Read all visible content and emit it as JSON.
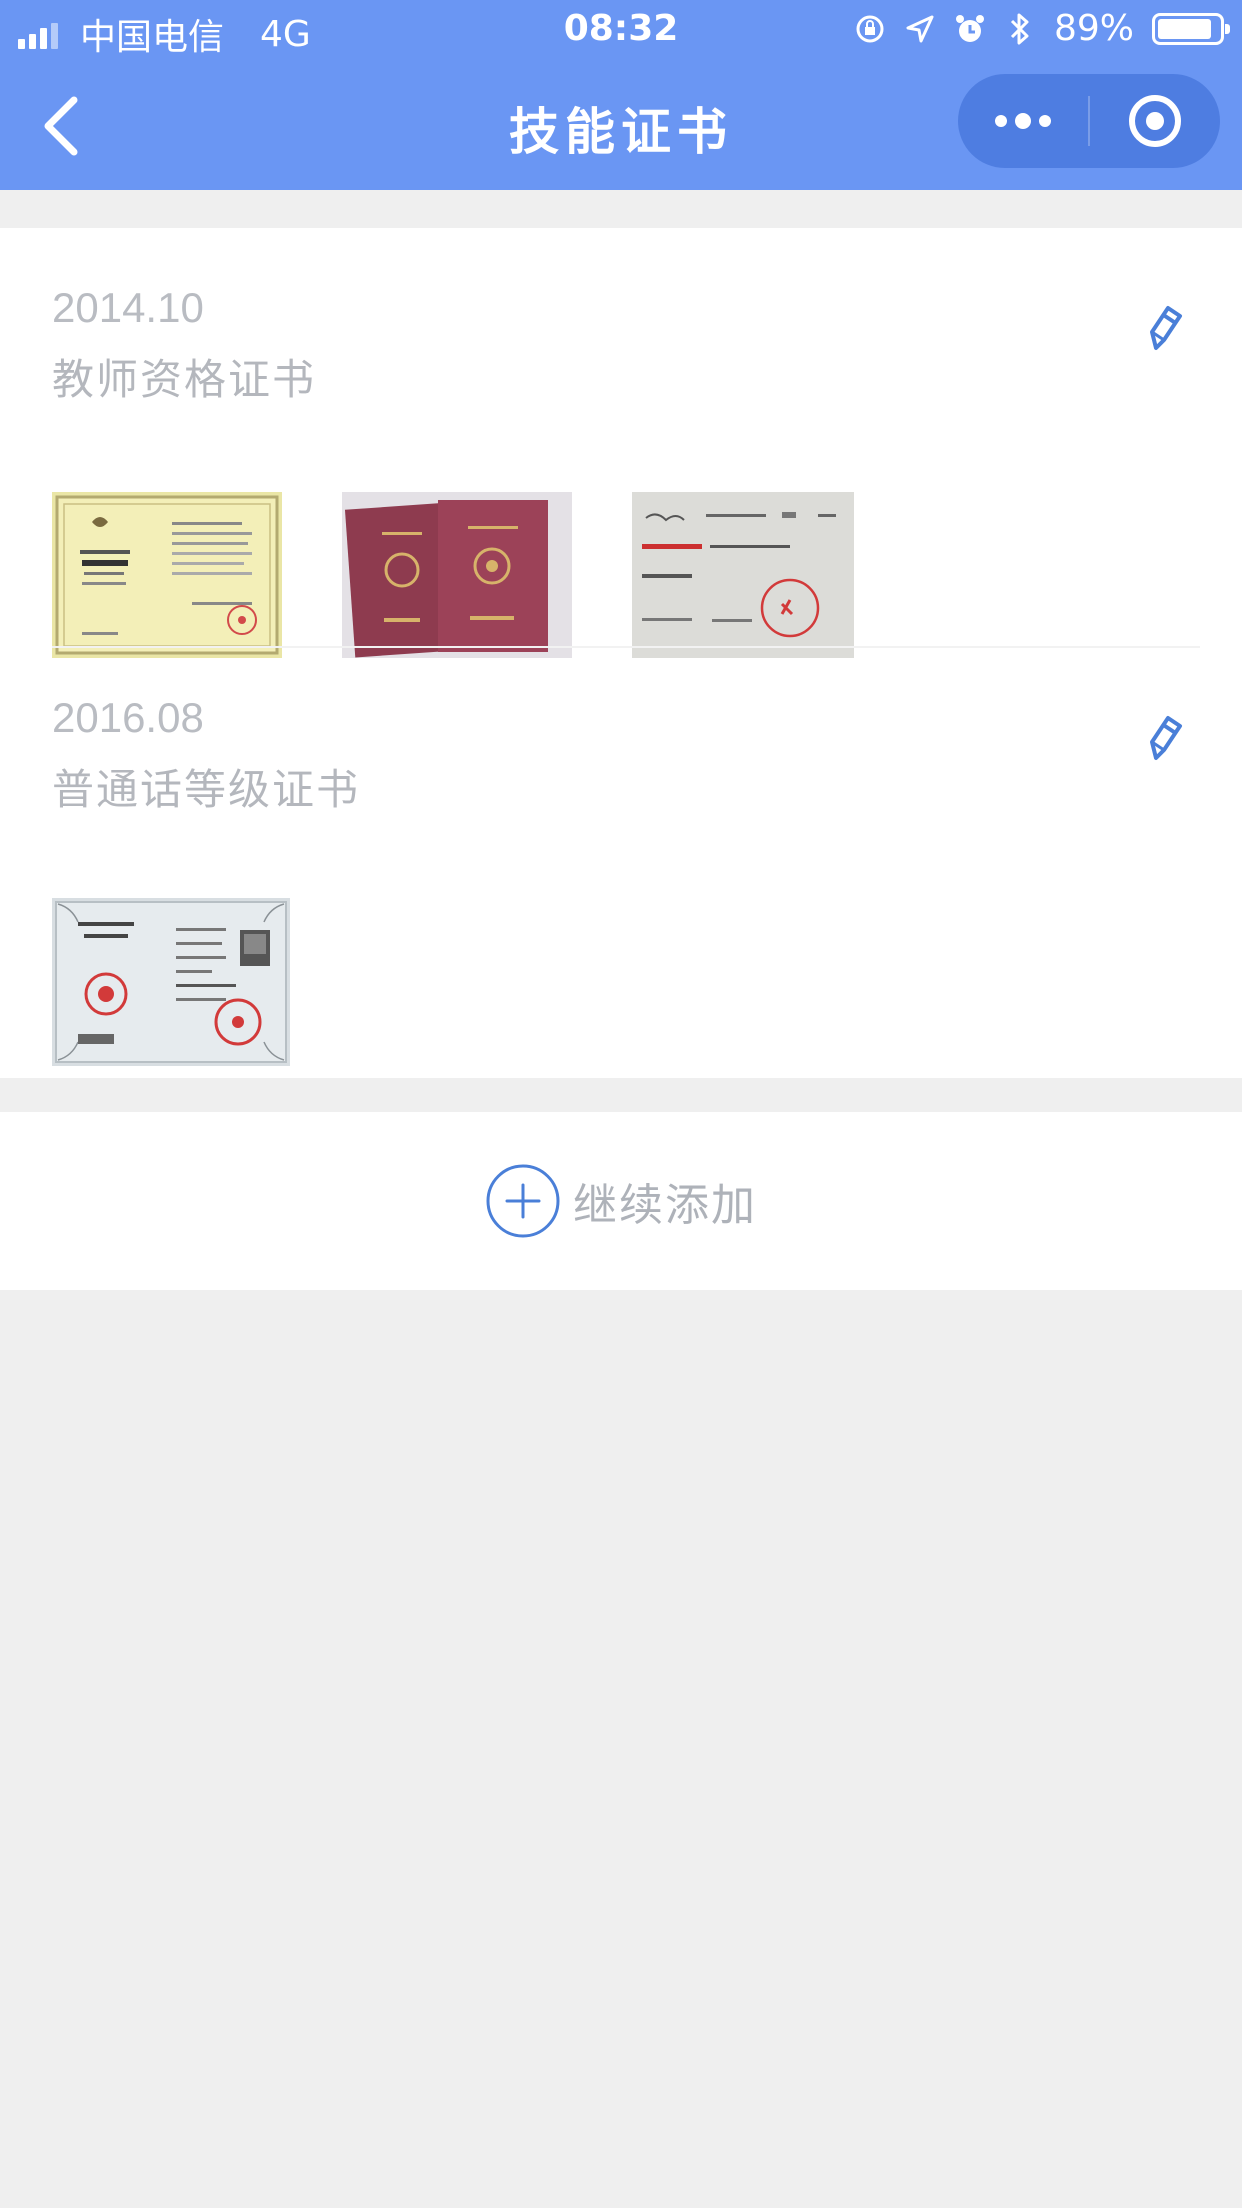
{
  "status_bar": {
    "carrier": "中国电信",
    "network": "4G",
    "time": "08:32",
    "battery": "89%",
    "battery_level": 0.89
  },
  "navbar": {
    "title": "技能证书"
  },
  "certificates": [
    {
      "date": "2014.10",
      "name": "教师资格证书",
      "photo_count": 3
    },
    {
      "date": "2016.08",
      "name": "普通话等级证书",
      "photo_count": 1
    }
  ],
  "add_button": {
    "label": "继续添加"
  },
  "colors": {
    "header": "#6a96f3",
    "accent": "#4a7fd8",
    "muted_text": "#b4b7bd",
    "page_bg": "#efefef"
  },
  "icons": {
    "back": "chevron-left-icon",
    "more": "more-dots-icon",
    "close_target": "target-circle-icon",
    "edit": "pencil-icon",
    "add": "plus-circle-icon"
  }
}
